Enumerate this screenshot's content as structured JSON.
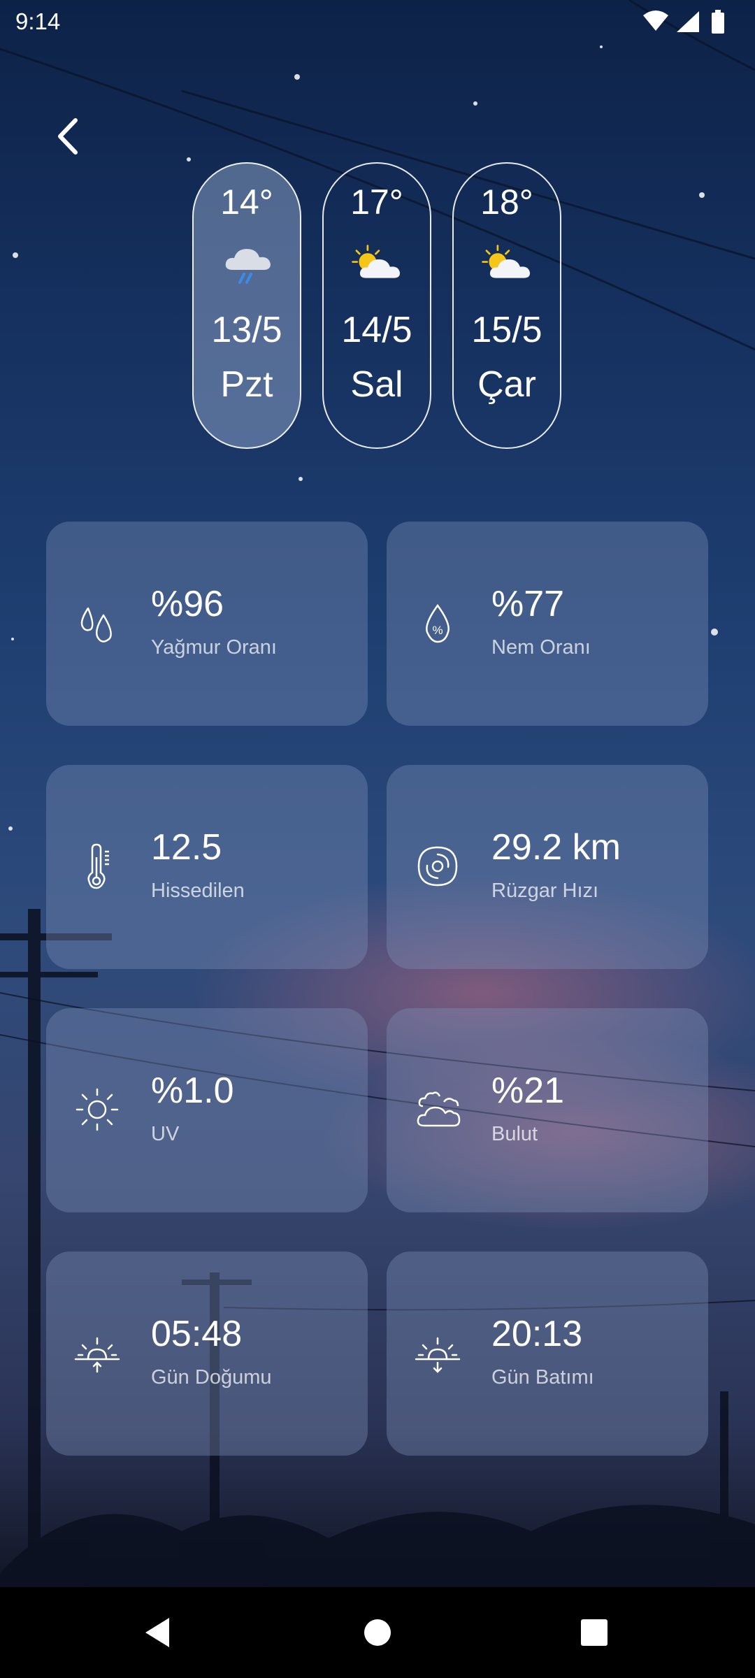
{
  "status_bar": {
    "time": "9:14",
    "icons": [
      "wifi-icon",
      "signal-icon",
      "battery-icon"
    ]
  },
  "header": {
    "back_icon": "chevron-left-icon"
  },
  "forecast": [
    {
      "temp": "14°",
      "icon": "cloud-rain-icon",
      "date": "13/5",
      "day": "Pzt",
      "selected": true
    },
    {
      "temp": "17°",
      "icon": "partly-cloudy-icon",
      "date": "14/5",
      "day": "Sal",
      "selected": false
    },
    {
      "temp": "18°",
      "icon": "partly-cloudy-icon",
      "date": "15/5",
      "day": "Çar",
      "selected": false
    }
  ],
  "metrics": [
    {
      "icon": "rain-drops-icon",
      "value": "%96",
      "label": "Yağmur Oranı"
    },
    {
      "icon": "humidity-icon",
      "value": "%77",
      "label": "Nem Oranı"
    },
    {
      "icon": "thermometer-icon",
      "value": "12.5",
      "label": "Hissedilen"
    },
    {
      "icon": "wind-icon",
      "value": "29.2 km",
      "label": "Rüzgar Hızı"
    },
    {
      "icon": "sun-icon",
      "value": "%1.0",
      "label": "UV"
    },
    {
      "icon": "clouds-icon",
      "value": "%21",
      "label": "Bulut"
    },
    {
      "icon": "sunrise-icon",
      "value": "05:48",
      "label": "Gün Doğumu"
    },
    {
      "icon": "sunset-icon",
      "value": "20:13",
      "label": "Gün Batımı"
    }
  ],
  "nav_bar": {
    "icons": [
      "nav-back-icon",
      "nav-home-icon",
      "nav-recents-icon"
    ]
  },
  "colors": {
    "sky_top": "#0d2247",
    "sky_mid": "#2d4a7b",
    "dusk_pink": "#c06a82",
    "card_bg": "#7d91b9",
    "sun_yellow": "#f5c518",
    "rain_blue": "#3d8be8"
  }
}
